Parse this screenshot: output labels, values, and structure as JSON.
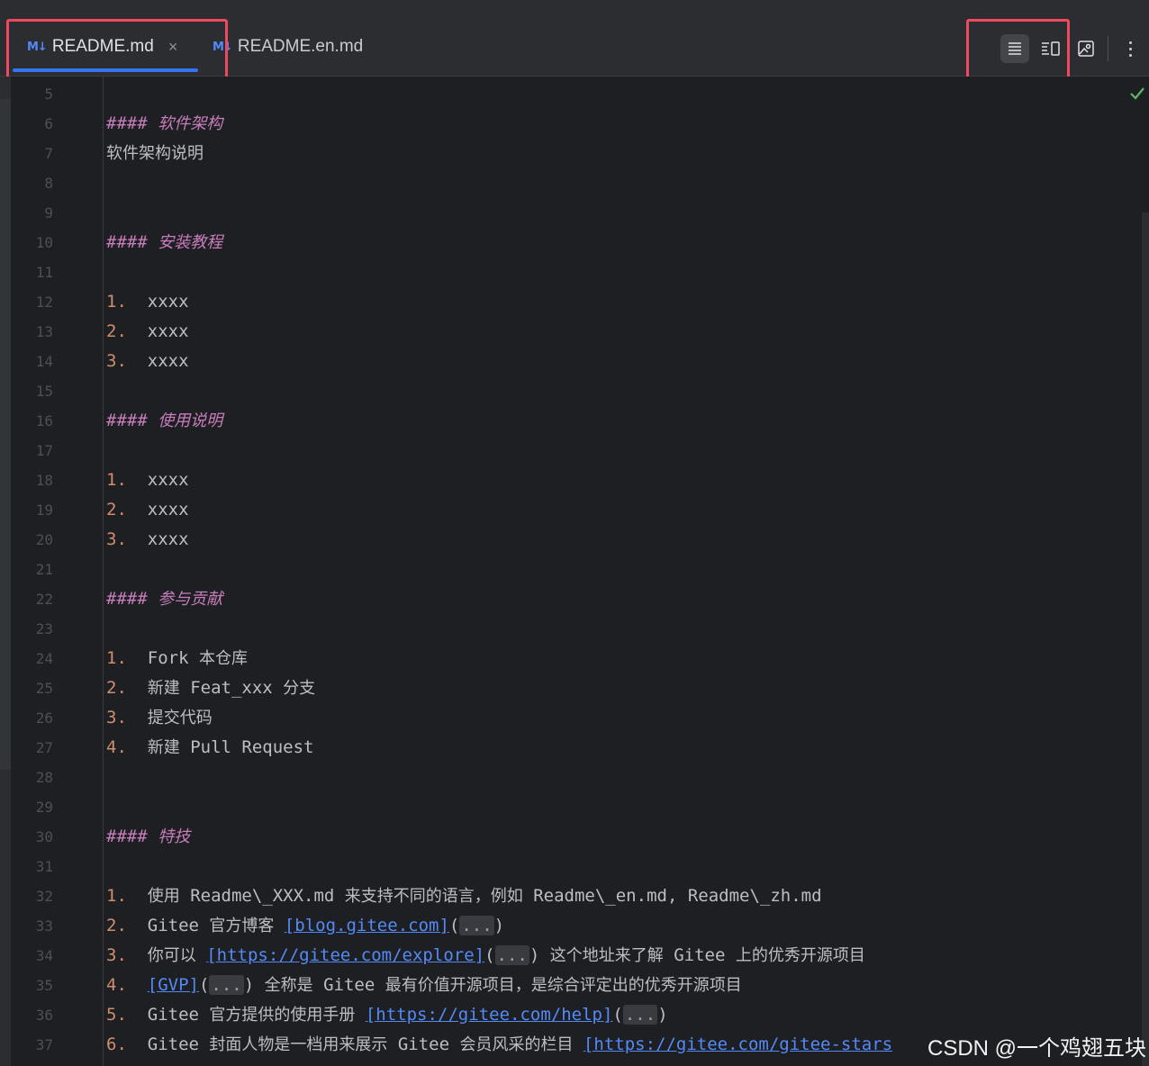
{
  "tabs": [
    {
      "icon": "M↓",
      "label": "README.md",
      "close": "×",
      "active": true
    },
    {
      "icon": "M↓",
      "label": "README.en.md",
      "active": false
    }
  ],
  "toolbar": {
    "buttons": [
      {
        "name": "editor-only-view-icon",
        "active": true
      },
      {
        "name": "editor-and-preview-view-icon",
        "active": false
      },
      {
        "name": "preview-only-view-icon",
        "active": false
      }
    ]
  },
  "colors": {
    "accent": "#3574f0",
    "highlight_box": "#f0495f",
    "header_text": "#c77dbb",
    "list_number": "#cf8e6d",
    "link": "#548af7",
    "check": "#5fb865"
  },
  "lines": [
    {
      "n": "5",
      "segs": []
    },
    {
      "n": "6",
      "segs": [
        {
          "t": "#### ",
          "c": "hdr"
        },
        {
          "t": "软件架构",
          "c": "hdr cn"
        }
      ]
    },
    {
      "n": "7",
      "segs": [
        {
          "t": "软件架构说明",
          "c": "cn"
        }
      ]
    },
    {
      "n": "8",
      "segs": []
    },
    {
      "n": "9",
      "segs": []
    },
    {
      "n": "10",
      "segs": [
        {
          "t": "#### ",
          "c": "hdr"
        },
        {
          "t": "安装教程",
          "c": "hdr cn"
        }
      ]
    },
    {
      "n": "11",
      "segs": []
    },
    {
      "n": "12",
      "segs": [
        {
          "t": "1.  ",
          "c": "num"
        },
        {
          "t": "xxxx",
          "c": ""
        }
      ]
    },
    {
      "n": "13",
      "segs": [
        {
          "t": "2.  ",
          "c": "num"
        },
        {
          "t": "xxxx",
          "c": ""
        }
      ]
    },
    {
      "n": "14",
      "segs": [
        {
          "t": "3.  ",
          "c": "num"
        },
        {
          "t": "xxxx",
          "c": ""
        }
      ]
    },
    {
      "n": "15",
      "segs": []
    },
    {
      "n": "16",
      "segs": [
        {
          "t": "#### ",
          "c": "hdr"
        },
        {
          "t": "使用说明",
          "c": "hdr cn"
        }
      ]
    },
    {
      "n": "17",
      "segs": []
    },
    {
      "n": "18",
      "segs": [
        {
          "t": "1.  ",
          "c": "num"
        },
        {
          "t": "xxxx",
          "c": ""
        }
      ]
    },
    {
      "n": "19",
      "segs": [
        {
          "t": "2.  ",
          "c": "num"
        },
        {
          "t": "xxxx",
          "c": ""
        }
      ]
    },
    {
      "n": "20",
      "segs": [
        {
          "t": "3.  ",
          "c": "num"
        },
        {
          "t": "xxxx",
          "c": ""
        }
      ]
    },
    {
      "n": "21",
      "segs": []
    },
    {
      "n": "22",
      "segs": [
        {
          "t": "#### ",
          "c": "hdr"
        },
        {
          "t": "参与贡献",
          "c": "hdr cn"
        }
      ]
    },
    {
      "n": "23",
      "segs": []
    },
    {
      "n": "24",
      "segs": [
        {
          "t": "1.  ",
          "c": "num"
        },
        {
          "t": "Fork ",
          "c": ""
        },
        {
          "t": "本仓库",
          "c": "cn"
        }
      ]
    },
    {
      "n": "25",
      "segs": [
        {
          "t": "2.  ",
          "c": "num"
        },
        {
          "t": "新建",
          "c": "cn"
        },
        {
          "t": " Feat_xxx ",
          "c": ""
        },
        {
          "t": "分支",
          "c": "cn"
        }
      ]
    },
    {
      "n": "26",
      "segs": [
        {
          "t": "3.  ",
          "c": "num"
        },
        {
          "t": "提交代码",
          "c": "cn"
        }
      ]
    },
    {
      "n": "27",
      "segs": [
        {
          "t": "4.  ",
          "c": "num"
        },
        {
          "t": "新建",
          "c": "cn"
        },
        {
          "t": " Pull Request",
          "c": ""
        }
      ]
    },
    {
      "n": "28",
      "segs": []
    },
    {
      "n": "29",
      "segs": []
    },
    {
      "n": "30",
      "segs": [
        {
          "t": "#### ",
          "c": "hdr"
        },
        {
          "t": "特技",
          "c": "hdr cn"
        }
      ]
    },
    {
      "n": "31",
      "segs": []
    },
    {
      "n": "32",
      "segs": [
        {
          "t": "1.  ",
          "c": "num"
        },
        {
          "t": "使用",
          "c": "cn"
        },
        {
          "t": " Readme\\_XXX.md ",
          "c": ""
        },
        {
          "t": "来支持不同的语言，例如",
          "c": "cn"
        },
        {
          "t": " Readme\\_en.md, Readme\\_zh.md",
          "c": ""
        }
      ]
    },
    {
      "n": "33",
      "segs": [
        {
          "t": "2.  ",
          "c": "num"
        },
        {
          "t": "Gitee ",
          "c": ""
        },
        {
          "t": "官方博客",
          "c": "cn"
        },
        {
          "t": " ",
          "c": ""
        },
        {
          "t": "[blog.gitee.com]",
          "c": "link"
        },
        {
          "t": "(",
          "c": "paren"
        },
        {
          "t": "...",
          "c": "fold"
        },
        {
          "t": ")",
          "c": "paren"
        }
      ]
    },
    {
      "n": "34",
      "segs": [
        {
          "t": "3.  ",
          "c": "num"
        },
        {
          "t": "你可以",
          "c": "cn"
        },
        {
          "t": " ",
          "c": ""
        },
        {
          "t": "[https://gitee.com/explore]",
          "c": "link"
        },
        {
          "t": "(",
          "c": "paren"
        },
        {
          "t": "...",
          "c": "fold"
        },
        {
          "t": ") ",
          "c": "paren"
        },
        {
          "t": "这个地址来了解",
          "c": "cn"
        },
        {
          "t": " Gitee ",
          "c": ""
        },
        {
          "t": "上的优秀开源项目",
          "c": "cn"
        }
      ]
    },
    {
      "n": "35",
      "segs": [
        {
          "t": "4.  ",
          "c": "num"
        },
        {
          "t": "[GVP]",
          "c": "link"
        },
        {
          "t": "(",
          "c": "paren"
        },
        {
          "t": "...",
          "c": "fold"
        },
        {
          "t": ") ",
          "c": "paren"
        },
        {
          "t": "全称是",
          "c": "cn"
        },
        {
          "t": " Gitee ",
          "c": ""
        },
        {
          "t": "最有价值开源项目，是综合评定出的优秀开源项目",
          "c": "cn"
        }
      ]
    },
    {
      "n": "36",
      "segs": [
        {
          "t": "5.  ",
          "c": "num"
        },
        {
          "t": "Gitee ",
          "c": ""
        },
        {
          "t": "官方提供的使用手册",
          "c": "cn"
        },
        {
          "t": " ",
          "c": ""
        },
        {
          "t": "[https://gitee.com/help]",
          "c": "link"
        },
        {
          "t": "(",
          "c": "paren"
        },
        {
          "t": "...",
          "c": "fold"
        },
        {
          "t": ")",
          "c": "paren"
        }
      ]
    },
    {
      "n": "37",
      "segs": [
        {
          "t": "6.  ",
          "c": "num"
        },
        {
          "t": "Gitee ",
          "c": ""
        },
        {
          "t": "封面人物是一档用来展示",
          "c": "cn"
        },
        {
          "t": " Gitee ",
          "c": ""
        },
        {
          "t": "会员风采的栏目",
          "c": "cn"
        },
        {
          "t": " ",
          "c": ""
        },
        {
          "t": "[https://gitee.com/gitee-stars",
          "c": "link"
        }
      ]
    }
  ],
  "watermark": "CSDN @一个鸡翅五块"
}
